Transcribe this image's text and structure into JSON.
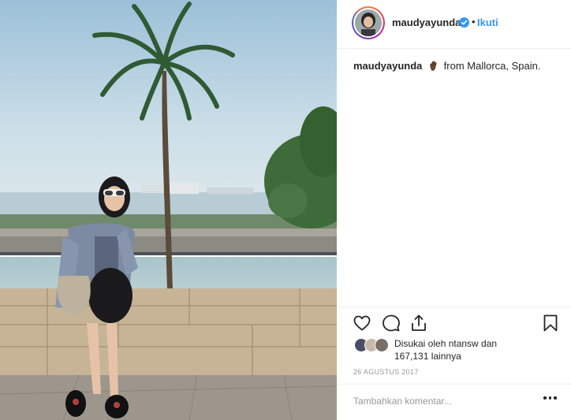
{
  "post": {
    "image_description": "photo",
    "author": {
      "username": "maudyayunda",
      "verified": true,
      "separator": "•",
      "follow_label": "Ikuti"
    },
    "caption": {
      "username": "maudyayunda",
      "emoji": "hand-emoji",
      "text": "from Mallorca, Spain."
    },
    "actions": {
      "like_icon": "heart-icon",
      "comment_icon": "comment-icon",
      "share_icon": "share-icon",
      "save_icon": "bookmark-icon"
    },
    "likes": {
      "line1": "Disukai oleh ntansw dan",
      "line2": "167,131 lainnya"
    },
    "date": "26 AGUSTUS 2017",
    "comment": {
      "placeholder": "Tambahkan komentar..."
    }
  },
  "colors": {
    "link": "#3897f0",
    "text": "#262626",
    "muted": "#999999",
    "border": "#efefef"
  }
}
